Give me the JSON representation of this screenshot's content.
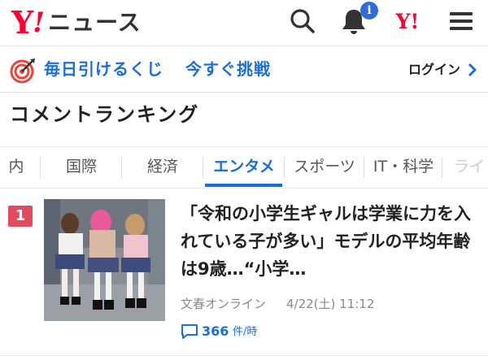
{
  "header": {
    "logo_y": "Y",
    "logo_bang": "!",
    "logo_text": "ニュース",
    "notification_badge": "i",
    "yjapan_mark": "Y!"
  },
  "promo": {
    "lottery_text": "毎日引けるくじ",
    "cta_text": "今すぐ挑戦",
    "login_label": "ログイン"
  },
  "section": {
    "title": "コメントランキング"
  },
  "tabs": [
    {
      "label": "内"
    },
    {
      "label": "国際"
    },
    {
      "label": "経済"
    },
    {
      "label": "エンタメ",
      "active": true
    },
    {
      "label": "スポーツ"
    },
    {
      "label": "IT・科学"
    },
    {
      "label": "ライ"
    }
  ],
  "article": {
    "rank": "1",
    "headline": "「令和の小学生ギャルは学業に力を入れている子が多い」モデルの平均年齢は9歳…“小学…",
    "source": "文春オンライン",
    "date": "4/22(土) 11:12",
    "comment_count": "366",
    "comment_unit": "件/時"
  },
  "colors": {
    "brand_red": "#ff0033",
    "accent_blue": "#1a6ed8",
    "rank_red": "#e44a5e",
    "badge_blue": "#2f6bdc"
  }
}
